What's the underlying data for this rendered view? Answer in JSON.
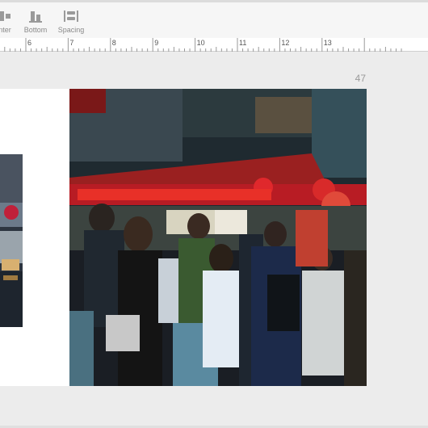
{
  "toolbar": {
    "items": [
      {
        "label": "nter",
        "icon": "align-center-icon"
      },
      {
        "label": "Bottom",
        "icon": "align-bottom-icon"
      },
      {
        "label": "Spacing",
        "icon": "spacing-icon"
      }
    ]
  },
  "ruler": {
    "ticks": [
      "6",
      "7",
      "8",
      "9",
      "10",
      "11",
      "12",
      "13"
    ]
  },
  "page": {
    "number": "47"
  },
  "colors": {
    "background": "#ececec",
    "toolbar": "#f6f6f6",
    "icon": "#9a9a9a"
  }
}
